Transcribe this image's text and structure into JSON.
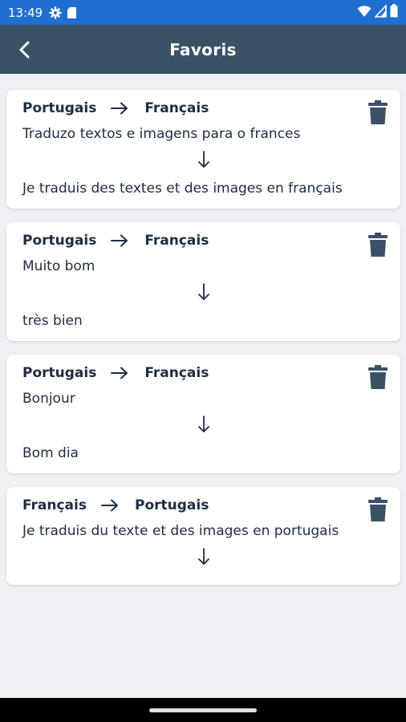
{
  "status_bar": {
    "time": "13:49",
    "left_icons": [
      "gear-icon",
      "sd-card-icon"
    ],
    "right_icons": [
      "wifi-icon",
      "signal-icon",
      "battery-icon"
    ],
    "color": "#1f6fd1"
  },
  "app_bar": {
    "title": "Favoris",
    "back_icon": "back-arrow-icon",
    "color": "#3b5166"
  },
  "favorites": [
    {
      "source_lang": "Portugais",
      "target_lang": "Français",
      "source_text": "Traduzo textos e imagens para o frances",
      "translated_text": "Je traduis des textes et des images en français"
    },
    {
      "source_lang": "Portugais",
      "target_lang": "Français",
      "source_text": "Muito bom",
      "translated_text": "très bien"
    },
    {
      "source_lang": "Portugais",
      "target_lang": "Français",
      "source_text": "Bonjour",
      "translated_text": "Bom dia"
    },
    {
      "source_lang": "Français",
      "target_lang": "Portugais",
      "source_text": "Je traduis du texte et des images en portugais",
      "translated_text": ""
    }
  ],
  "icons": {
    "direction": "arrow-right-icon",
    "result": "arrow-down-icon",
    "delete": "trash-icon"
  },
  "text_color": "#1e2d42",
  "icon_color": "#3b5166"
}
